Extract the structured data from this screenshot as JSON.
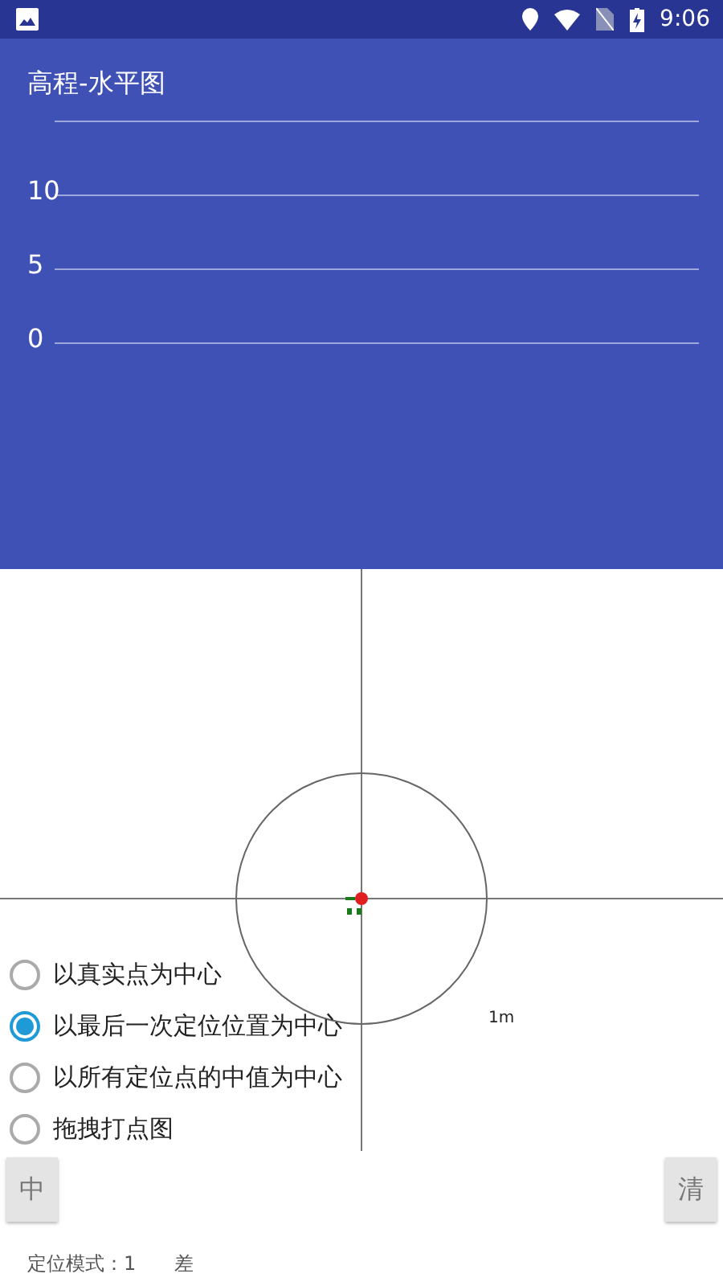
{
  "status_bar": {
    "time": "9:06"
  },
  "app_bar": {
    "title": "高程-水平图",
    "y_axis_labels": [
      "10",
      "5",
      "0"
    ]
  },
  "plot": {
    "scale_label": "1m"
  },
  "center_options": [
    {
      "label": "以真实点为中心",
      "selected": false
    },
    {
      "label": "以最后一次定位位置为中心",
      "selected": true
    },
    {
      "label": "以所有定位点的中值为中心",
      "selected": false
    },
    {
      "label": "拖拽打点图",
      "selected": false
    }
  ],
  "buttons": [
    "中",
    "清"
  ],
  "footer": [
    "定位模式：1",
    "差"
  ]
}
